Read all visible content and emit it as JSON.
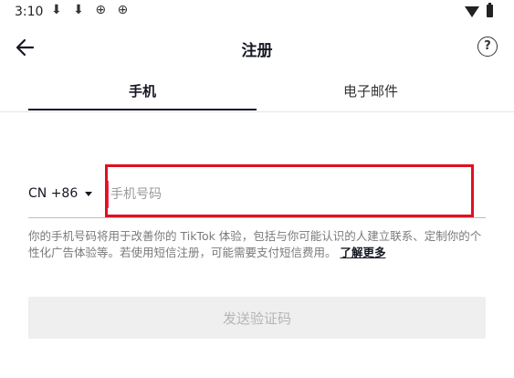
{
  "status_bar": {
    "time": "3:10",
    "left_icons": "⬇ ⬇ ⊕ ⊕"
  },
  "header": {
    "title": "注册",
    "help_label": "?"
  },
  "tabs": [
    {
      "label": "手机",
      "selected": true
    },
    {
      "label": "电子邮件",
      "selected": false
    }
  ],
  "phone_form": {
    "country_code": "CN +86",
    "phone_placeholder": "手机号码",
    "phone_value": ""
  },
  "disclaimer": {
    "text": "你的手机号码将用于改善你的 TikTok 体验，包括与你可能认识的人建立联系、定制你的个性化广告体验等。若使用短信注册，可能需要支付短信费用。",
    "link_label": "了解更多"
  },
  "send_code_button": "发送验证码",
  "colors": {
    "highlight": "#e0101e",
    "cursor": "#fe2c55",
    "button_disabled_bg": "#efefef"
  }
}
